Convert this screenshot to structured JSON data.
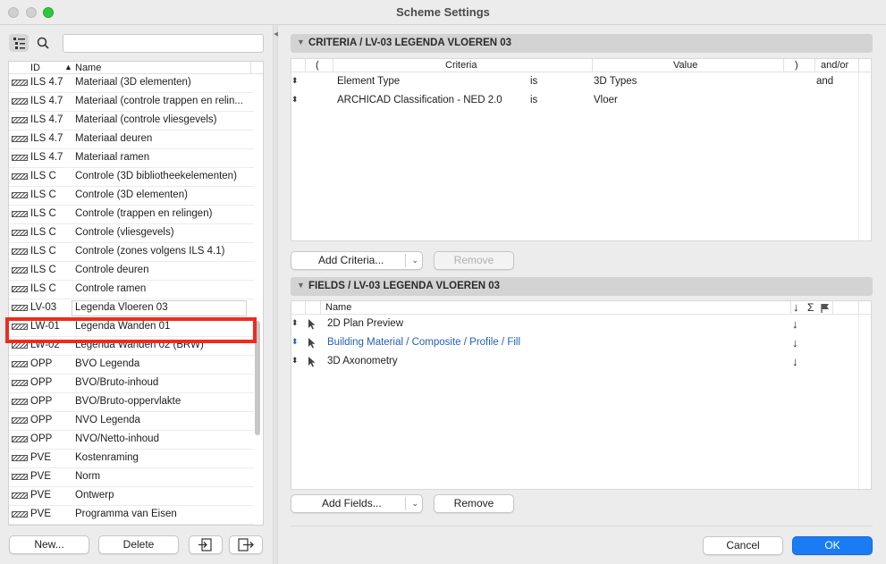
{
  "window": {
    "title": "Scheme Settings"
  },
  "left": {
    "search_placeholder": "",
    "columns": {
      "id": "ID",
      "name": "Name",
      "sort_indicator": "▲"
    },
    "rows": [
      {
        "id": "ILS 4.7",
        "name": "Materiaal (3D elementen)"
      },
      {
        "id": "ILS 4.7",
        "name": "Materiaal (controle trappen en relin..."
      },
      {
        "id": "ILS 4.7",
        "name": "Materiaal (controle vliesgevels)"
      },
      {
        "id": "ILS 4.7",
        "name": "Materiaal deuren"
      },
      {
        "id": "ILS 4.7",
        "name": "Materiaal ramen"
      },
      {
        "id": "ILS C",
        "name": "Controle (3D bibliotheekelementen)"
      },
      {
        "id": "ILS C",
        "name": "Controle (3D elementen)"
      },
      {
        "id": "ILS C",
        "name": "Controle (trappen en relingen)"
      },
      {
        "id": "ILS C",
        "name": "Controle (vliesgevels)"
      },
      {
        "id": "ILS C",
        "name": "Controle (zones volgens ILS 4.1)"
      },
      {
        "id": "ILS C",
        "name": "Controle deuren"
      },
      {
        "id": "ILS C",
        "name": "Controle ramen"
      },
      {
        "id": "LV-03",
        "name": "Legenda Vloeren 03"
      },
      {
        "id": "LW-01",
        "name": "Legenda Wanden 01"
      },
      {
        "id": "LW-02",
        "name": "Legenda Wanden 02 (BRW)"
      },
      {
        "id": "OPP",
        "name": "BVO Legenda"
      },
      {
        "id": "OPP",
        "name": "BVO/Bruto-inhoud"
      },
      {
        "id": "OPP",
        "name": "BVO/Bruto-oppervlakte"
      },
      {
        "id": "OPP",
        "name": "NVO Legenda"
      },
      {
        "id": "OPP",
        "name": "NVO/Netto-inhoud"
      },
      {
        "id": "PVE",
        "name": "Kostenraming"
      },
      {
        "id": "PVE",
        "name": "Norm"
      },
      {
        "id": "PVE",
        "name": "Ontwerp"
      },
      {
        "id": "PVE",
        "name": "Programma van Eisen"
      }
    ],
    "buttons": {
      "new": "New...",
      "delete": "Delete"
    }
  },
  "criteria": {
    "header": "CRITERIA / LV-03 LEGENDA VLOEREN 03",
    "columns": {
      "open": "(",
      "criteria": "Criteria",
      "value": "Value",
      "close": ")",
      "andor": "and/or"
    },
    "rows": [
      {
        "field": "Element Type",
        "op": "is",
        "value": "3D Types",
        "andor": "and"
      },
      {
        "field": "ARCHICAD Classification - NED 2.0",
        "op": "is",
        "value": "Vloer",
        "andor": ""
      }
    ],
    "add_button": "Add Criteria...",
    "remove_button": "Remove"
  },
  "fields": {
    "header": "FIELDS / LV-03 LEGENDA VLOEREN 03",
    "columns": {
      "name": "Name",
      "sort": "↓",
      "sum": "Σ"
    },
    "rows": [
      {
        "name": "2D Plan Preview",
        "sort": "↓"
      },
      {
        "name": "Building Material / Composite / Profile / Fill",
        "sort": "↓"
      },
      {
        "name": "3D Axonometry",
        "sort": "↓"
      }
    ],
    "add_button": "Add Fields...",
    "remove_button": "Remove"
  },
  "footer": {
    "cancel": "Cancel",
    "ok": "OK"
  },
  "colors": {
    "accent": "#1a7cf5",
    "highlight": "#f02a1f",
    "link": "#2361b9"
  }
}
